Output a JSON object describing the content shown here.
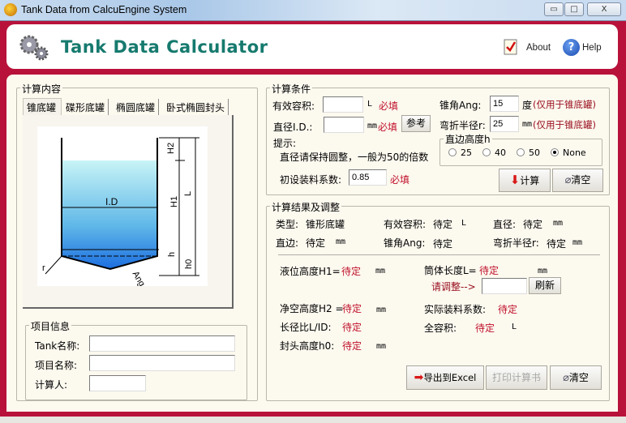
{
  "window": {
    "title": "Tank Data from CalcuEngine System",
    "minimize": "▭",
    "maximize": "□",
    "close": "X"
  },
  "header": {
    "title": "Tank Data Calculator",
    "about": "About",
    "help": "Help"
  },
  "content": {
    "legend": "计算内容",
    "tabs": [
      "锥底罐",
      "碟形底罐",
      "椭圆底罐",
      "卧式椭圆封头"
    ],
    "active_tab": 0,
    "diagram": {
      "labels": {
        "id": "I.D",
        "h2": "H2",
        "h1": "H1",
        "l": "L",
        "h": "h",
        "h0": "h0",
        "r": "r",
        "ang": "Ang"
      }
    }
  },
  "project": {
    "legend": "项目信息",
    "tank_name_label": "Tank名称:",
    "project_name_label": "项目名称:",
    "calculator_label": "计算人:",
    "tank_name": "",
    "project_name": "",
    "calculator": ""
  },
  "conditions": {
    "legend": "计算条件",
    "volume_label": "有效容积:",
    "volume_value": "",
    "volume_unit": "L",
    "required": "必填",
    "diameter_label": "直径I.D.:",
    "diameter_value": "",
    "diameter_unit": "mm",
    "reference_button": "参考",
    "hint_label": "提示:",
    "hint_text": "直径请保持圆整，一般为50的倍数",
    "fill_label": "初设装料系数:",
    "fill_value": "0.85",
    "angle_label": "锥角Ang:",
    "angle_value": "15",
    "angle_unit": "度",
    "cone_only": "(仅用于锥底罐)",
    "radius_label": "弯折半径r:",
    "radius_value": "25",
    "radius_unit": "mm",
    "straight_legend": "直边高度h",
    "straight_options": [
      "25",
      "40",
      "50",
      "None"
    ],
    "straight_selected": "None",
    "calc_button": "计算",
    "clear_button": "清空"
  },
  "results": {
    "legend": "计算结果及调整",
    "type_label": "类型:",
    "type_value": "锥形底罐",
    "eff_volume_label": "有效容积:",
    "eff_volume_value": "待定",
    "eff_volume_unit": "L",
    "diameter_label": "直径:",
    "diameter_value": "待定",
    "diameter_unit": "mm",
    "straight_label": "直边:",
    "straight_value": "待定",
    "straight_unit": "mm",
    "angle_label": "锥角Ang:",
    "angle_value": "待定",
    "radius_label": "弯折半径r:",
    "radius_value": "待定",
    "radius_unit": "mm",
    "h1_label": "液位高度H1=",
    "h1_value": "待定",
    "h1_unit": "mm",
    "length_label": "筒体长度L=",
    "length_value": "待定",
    "length_unit": "mm",
    "adjust_label": "请调整-->",
    "adjust_value": "",
    "refresh_button": "刷新",
    "h2_label": "净空高度H2 =",
    "h2_value": "待定",
    "h2_unit": "mm",
    "fill_label": "实际装料系数:",
    "fill_value": "待定",
    "ratio_label": "长径比L/ID:",
    "ratio_value": "待定",
    "total_label": "全容积:",
    "total_value": "待定",
    "total_unit": "L",
    "h0_label": "封头高度h0:",
    "h0_value": "待定",
    "h0_unit": "mm",
    "export_button": "导出到Excel",
    "print_button": "打印计算书",
    "clear_button": "清空"
  },
  "colors": {
    "frame": "#b8123a",
    "accent": "#167a6e",
    "required": "#c0102a"
  }
}
